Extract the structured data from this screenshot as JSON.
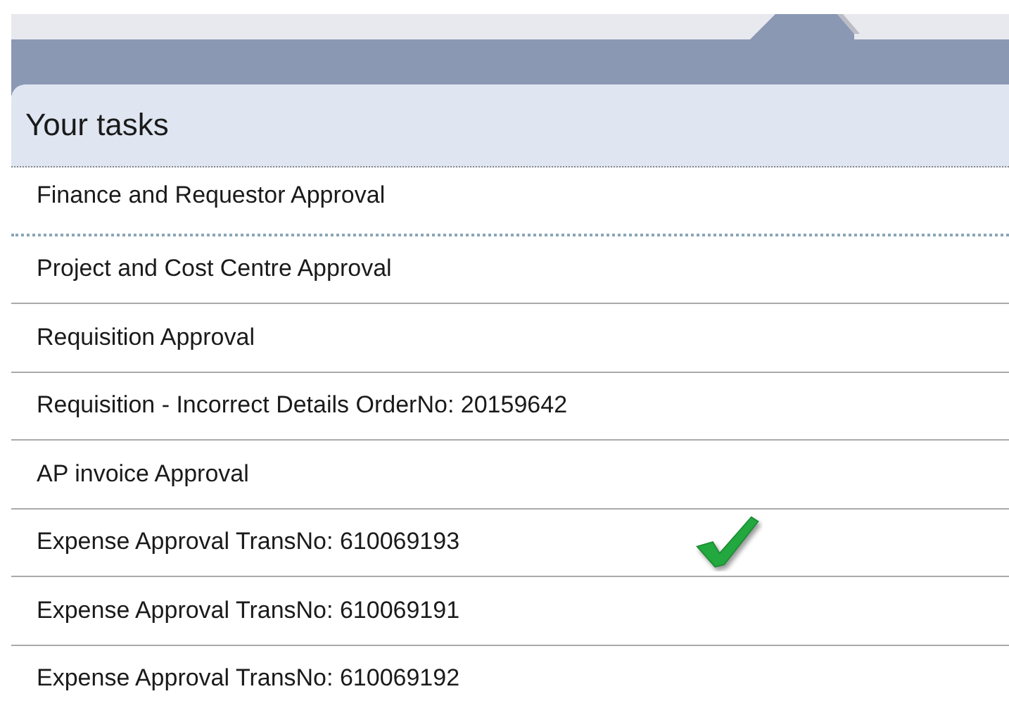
{
  "panel": {
    "title": "Your tasks"
  },
  "tasks": [
    {
      "label": "Finance and Requestor Approval",
      "selected": true,
      "checked": false
    },
    {
      "label": "Project and Cost Centre Approval",
      "selected": false,
      "checked": false
    },
    {
      "label": "Requisition Approval",
      "selected": false,
      "checked": false
    },
    {
      "label": "Requisition - Incorrect Details OrderNo: 20159642",
      "selected": false,
      "checked": false
    },
    {
      "label": "AP invoice Approval",
      "selected": false,
      "checked": false
    },
    {
      "label": "Expense Approval TransNo: 610069193",
      "selected": false,
      "checked": true
    },
    {
      "label": "Expense Approval TransNo: 610069191",
      "selected": false,
      "checked": false
    },
    {
      "label": "Expense Approval TransNo: 610069192",
      "selected": false,
      "checked": false
    }
  ]
}
